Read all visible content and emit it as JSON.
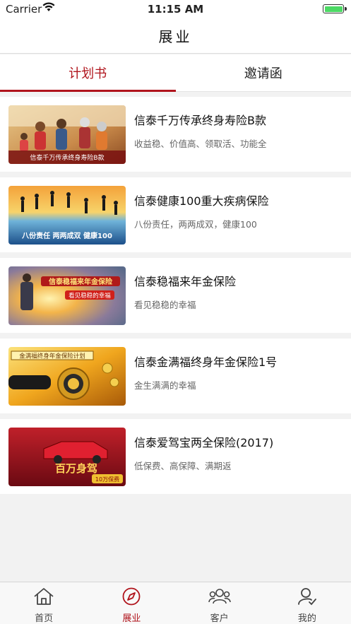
{
  "status": {
    "carrier": "Carrier",
    "time": "11:15 AM",
    "battery_level": 1.0
  },
  "nav": {
    "title": "展业"
  },
  "tabs": [
    {
      "label": "计划书",
      "active": true
    },
    {
      "label": "邀请函",
      "active": false
    }
  ],
  "products": [
    {
      "name": "信泰千万传承终身寿险B款",
      "desc": "收益稳、价值高、领取活、功能全",
      "banner_text": "信泰千万传承终身寿险B款"
    },
    {
      "name": "信泰健康100重大疾病保险",
      "desc": "八份责任，两两成双，健康100",
      "banner_text": "八份责任  两两成双  健康100"
    },
    {
      "name": "信泰稳福来年金保险",
      "desc": "看见稳稳的幸福",
      "banner_text": "信泰稳福来年金保险",
      "banner_sub": "看见稳稳的幸福"
    },
    {
      "name": "信泰金满福终身年金保险1号",
      "desc": "金生满满的幸福",
      "banner_text": "金满福终身年金保险计划"
    },
    {
      "name": "信泰爱驾宝两全保险(2017)",
      "desc": "低保费、高保障、满期返",
      "banner_text": "百万身驾",
      "banner_sub": "10万保费"
    }
  ],
  "tabbar": [
    {
      "label": "首页",
      "icon": "home-icon",
      "active": false
    },
    {
      "label": "展业",
      "icon": "compass-icon",
      "active": true
    },
    {
      "label": "客户",
      "icon": "customers-icon",
      "active": false
    },
    {
      "label": "我的",
      "icon": "profile-icon",
      "active": false
    }
  ],
  "colors": {
    "accent": "#b0141c",
    "background": "#f2f2f2",
    "card": "#ffffff",
    "battery": "#4cd964"
  }
}
